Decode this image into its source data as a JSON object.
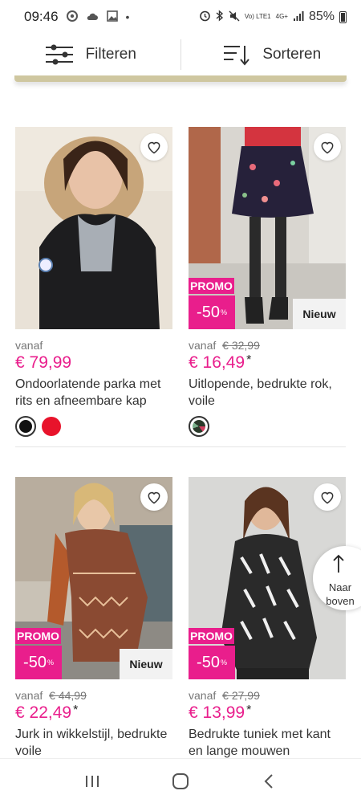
{
  "status": {
    "time": "09:46",
    "battery": "85%",
    "network": "4G+",
    "volte": "Vo) LTE1"
  },
  "toolbar": {
    "filter_label": "Filteren",
    "sort_label": "Sorteren"
  },
  "products": [
    {
      "from_label": "vanaf",
      "old_price": "",
      "price": "€ 79,99",
      "price_star": "",
      "name": "Ondoorlatende parka met rits en afneembare kap",
      "promo_label": "",
      "promo_pct": "",
      "badge": "",
      "swatches": [
        "#111111",
        "#e8132b"
      ]
    },
    {
      "from_label": "vanaf",
      "old_price": "€ 32,99",
      "price": "€ 16,49",
      "price_star": "*",
      "name": "Uitlopende, bedrukte rok, voile",
      "promo_label": "PROMO",
      "promo_pct": "-50",
      "badge": "Nieuw",
      "swatches": [
        "#3a4a3a"
      ]
    },
    {
      "from_label": "vanaf",
      "old_price": "€ 44,99",
      "price": "€ 22,49",
      "price_star": "*",
      "name": "Jurk in wikkelstijl, bedrukte voile",
      "promo_label": "PROMO",
      "promo_pct": "-50",
      "badge": "Nieuw",
      "swatches": []
    },
    {
      "from_label": "vanaf",
      "old_price": "€ 27,99",
      "price": "€ 13,99",
      "price_star": "*",
      "name": "Bedrukte tuniek met kant en lange mouwen",
      "promo_label": "PROMO",
      "promo_pct": "-50",
      "badge": "",
      "swatches": []
    }
  ],
  "back_to_top": {
    "label": "Naar boven"
  },
  "colors": {
    "accent": "#e91e8c",
    "price": "#e91e8c"
  }
}
